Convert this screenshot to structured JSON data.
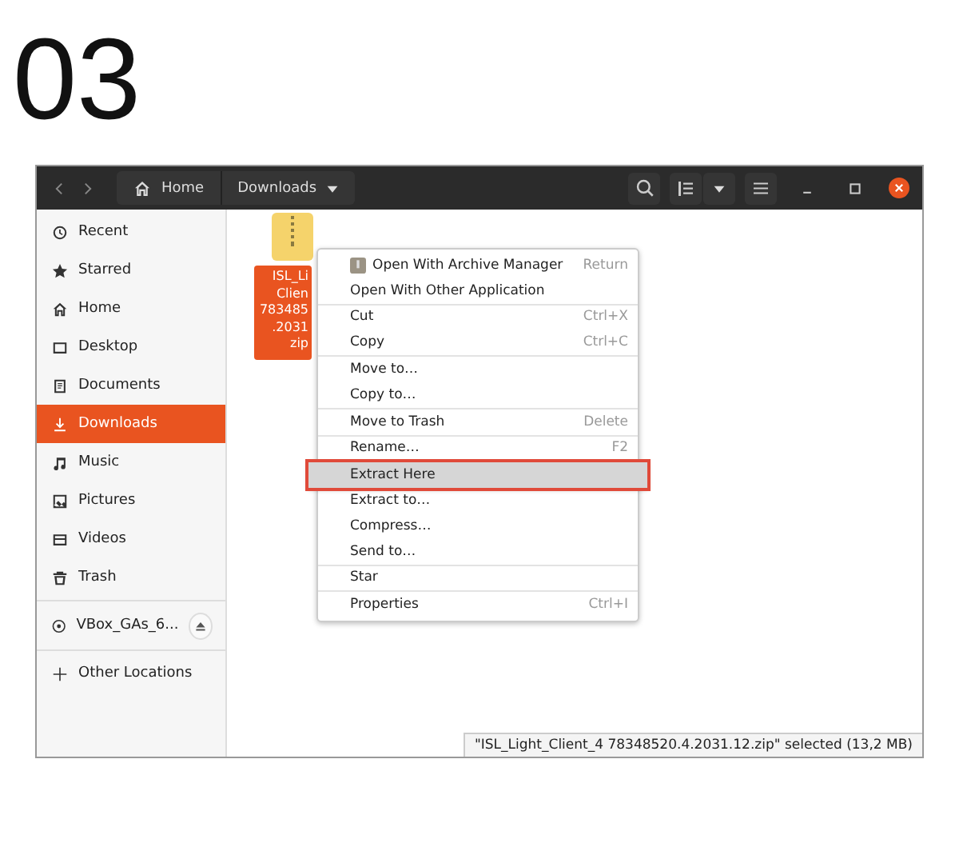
{
  "step_number": "03",
  "header": {
    "path": [
      {
        "label": "Home",
        "kind": "home"
      },
      {
        "label": "Downloads",
        "kind": "current"
      }
    ]
  },
  "sidebar": {
    "places": [
      {
        "label": "Recent",
        "selected": false
      },
      {
        "label": "Starred",
        "selected": false
      },
      {
        "label": "Home",
        "selected": false
      },
      {
        "label": "Desktop",
        "selected": false
      },
      {
        "label": "Documents",
        "selected": false
      },
      {
        "label": "Downloads",
        "selected": true
      },
      {
        "label": "Music",
        "selected": false
      },
      {
        "label": "Pictures",
        "selected": false
      },
      {
        "label": "Videos",
        "selected": false
      },
      {
        "label": "Trash",
        "selected": false
      }
    ],
    "devices": [
      {
        "label": "VBox_GAs_6..."
      }
    ],
    "other": {
      "label": "Other Locations"
    }
  },
  "file": {
    "label_lines": [
      "ISL_Li",
      "Clien",
      "783485",
      ".2031",
      "zip"
    ],
    "selected": true
  },
  "context_menu": {
    "groups": [
      [
        {
          "label": "Open With Archive Manager",
          "shortcut": "Return",
          "selected": false,
          "kind": "with_icon"
        },
        {
          "label": "Open With Other Application",
          "selected": false
        }
      ],
      [
        {
          "label": "Cut",
          "shortcut": "Ctrl+X",
          "selected": false
        },
        {
          "label": "Copy",
          "shortcut": "Ctrl+C",
          "selected": false
        }
      ],
      [
        {
          "label": "Move to…",
          "selected": false
        },
        {
          "label": "Copy to…",
          "selected": false
        }
      ],
      [
        {
          "label": "Move to Trash",
          "shortcut": "Delete",
          "selected": false
        }
      ],
      [
        {
          "label": "Rename…",
          "shortcut": "F2",
          "selected": false
        }
      ],
      [
        {
          "label": "Extract Here",
          "selected": true
        },
        {
          "label": "Extract to…",
          "selected": false
        },
        {
          "label": "Compress…",
          "selected": false
        },
        {
          "label": "Send to…",
          "selected": false
        }
      ],
      [
        {
          "label": "Star",
          "selected": false
        }
      ],
      [
        {
          "label": "Properties",
          "shortcut": "Ctrl+I",
          "selected": false
        }
      ]
    ]
  },
  "status_bar": {
    "text": "\"ISL_Light_Client_4 78348520.4.2031.12.zip\" selected  (13,2 MB)"
  }
}
